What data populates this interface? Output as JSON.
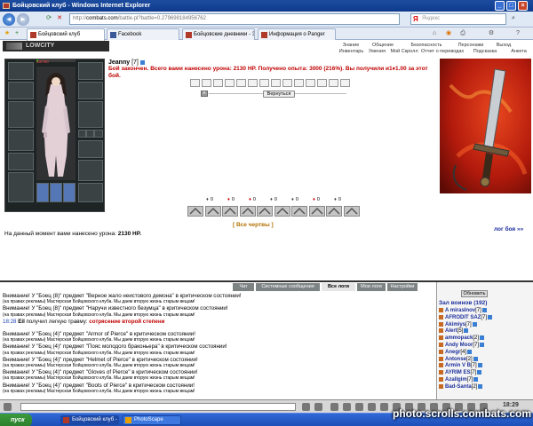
{
  "browser": {
    "title": "Бойцовский клуб - Windows Internet Explorer",
    "address": "http://",
    "address_host": "combats.com",
    "address_rest": "/battle.pl?battle=0.279698184956762",
    "search_placeholder": "Яндекс",
    "tabs": [
      {
        "label": "Бойцовский клуб",
        "icon": "fight-club-favicon",
        "color": "#b03a2a"
      },
      {
        "label": "Facebook",
        "icon": "facebook-favicon",
        "color": "#3b5998"
      },
      {
        "label": "Бойцовские дневники - Зва...",
        "icon": "diary-favicon",
        "color": "#b03a2a"
      },
      {
        "label": "Информация о Panger",
        "icon": "info-favicon",
        "color": "#b03a2a"
      }
    ]
  },
  "game": {
    "logo": "LOWCITY",
    "topnav_row1": [
      "Знание",
      "Общение",
      "Безопасность",
      "Персонажи",
      "Выход"
    ],
    "topnav_row2": [
      "Инвентарь",
      "Умения",
      "Мой Скролл",
      "Отчет о переводах",
      "Подсказка",
      "Анкета"
    ],
    "hp": "33/780",
    "player": {
      "name": "Jeanny",
      "level": "[7]"
    },
    "battle_end_message": "Бой закончен. Всего вами нанесено урона: 2130 HP. Получено опыта: 3000 (216%). Вы получили и1♦1.00 за этот бой.",
    "back_button": "Вернуться",
    "counters": [
      "0",
      "0",
      "0",
      "0",
      "0",
      "0",
      "0"
    ],
    "all_spells_link": "[ Все чертвы ]",
    "damage_now_prefix": "На данный момент вами нанесено урона:",
    "damage_now_value": "2130 HP.",
    "battle_log_link": "лог боя »»"
  },
  "chat": {
    "tabs": [
      "Чат",
      "Системные сообщения",
      "Все логи",
      "Мои логи",
      "Настройки"
    ],
    "active_tab": "Все логи",
    "lines": [
      {
        "text": "Внимание! У \"Боец (8)\" предмет \"Верное жало неистового демона\" в критическом состоянии!",
        "style": ""
      },
      {
        "text": "(на правах рекламы) Мастерская Бойцовского клуба. Мы даем вторую жизнь старым вещам!",
        "style": "sm"
      },
      {
        "text": "Внимание! У \"Боец (8)\" предмет \"Наручи известного безумца\" в критическом состоянии!",
        "style": ""
      },
      {
        "text": "(на правах рекламы) Мастерская Бойцовского клуба. Мы даем вторую жизнь старым вещам!",
        "style": "sm"
      },
      {
        "time": "18:28",
        "name": "Eil",
        "text": "получил легкую травму:",
        "red": "сотрясение второй степени",
        "style": "time"
      },
      {
        "text": "",
        "style": ""
      },
      {
        "text": "Внимание! У \"Боец (4)\" предмет \"Armor of Pierce\" в критическом состоянии!",
        "style": ""
      },
      {
        "text": "(на правах рекламы) Мастерская Бойцовского клуба. Мы даем вторую жизнь старым вещам!",
        "style": "sm"
      },
      {
        "text": "Внимание! У \"Боец (4)\" предмет \"Пояс молодого браконьера\" в критическом состоянии!",
        "style": ""
      },
      {
        "text": "(на правах рекламы) Мастерская Бойцовского клуба. Мы даем вторую жизнь старым вещам!",
        "style": "sm"
      },
      {
        "text": "Внимание! У \"Боец (4)\" предмет \"Helmet of Pierce\" в критическом состоянии!",
        "style": ""
      },
      {
        "text": "(на правах рекламы) Мастерская Бойцовского клуба. Мы даем вторую жизнь старым вещам!",
        "style": "sm"
      },
      {
        "text": "Внимание! У \"Боец (4)\" предмет \"Gloves of Pierce\" в критическом состоянии!",
        "style": ""
      },
      {
        "text": "(на правах рекламы) Мастерская Бойцовского клуба. Мы даем вторую жизнь старым вещам!",
        "style": "sm"
      },
      {
        "text": "Внимание! У \"Боец (4)\" предмет \"Boots of Pierce\" в критическом состоянии!",
        "style": ""
      },
      {
        "text": "(на правах рекламы) Мастерская Бойцовского клуба. Мы даем вторую жизнь старым вещам!",
        "style": "sm"
      }
    ]
  },
  "sidebar": {
    "refresh_button": "Обновить",
    "room_title": "Зал воинов (192)",
    "warriors": [
      {
        "name": "A mirasInov",
        "level": "[7]"
      },
      {
        "name": "AFRODIT SAZ",
        "level": "[7]"
      },
      {
        "name": "Akimiys",
        "level": "[7]"
      },
      {
        "name": "Alert",
        "level": "[5]"
      },
      {
        "name": "ammopack",
        "level": "[2]"
      },
      {
        "name": "Andy Moor",
        "level": "[7]"
      },
      {
        "name": "Anegr",
        "level": "[4]"
      },
      {
        "name": "Antonse",
        "level": "[2]"
      },
      {
        "name": "Armin V B",
        "level": "[7]"
      },
      {
        "name": "AYRIM ES",
        "level": "[7]"
      },
      {
        "name": "Azallgim",
        "level": "[7]"
      },
      {
        "name": "Bad-Santa",
        "level": "[2]"
      }
    ]
  },
  "bottombar": {
    "clock": "18:29"
  },
  "taskbar": {
    "start": "пуск",
    "buttons": [
      {
        "label": "Бойцовский клуб - Wi...",
        "active": true
      },
      {
        "label": "PhotoScape",
        "active": false
      }
    ]
  },
  "watermark": "photo.scrolls.combats.com"
}
